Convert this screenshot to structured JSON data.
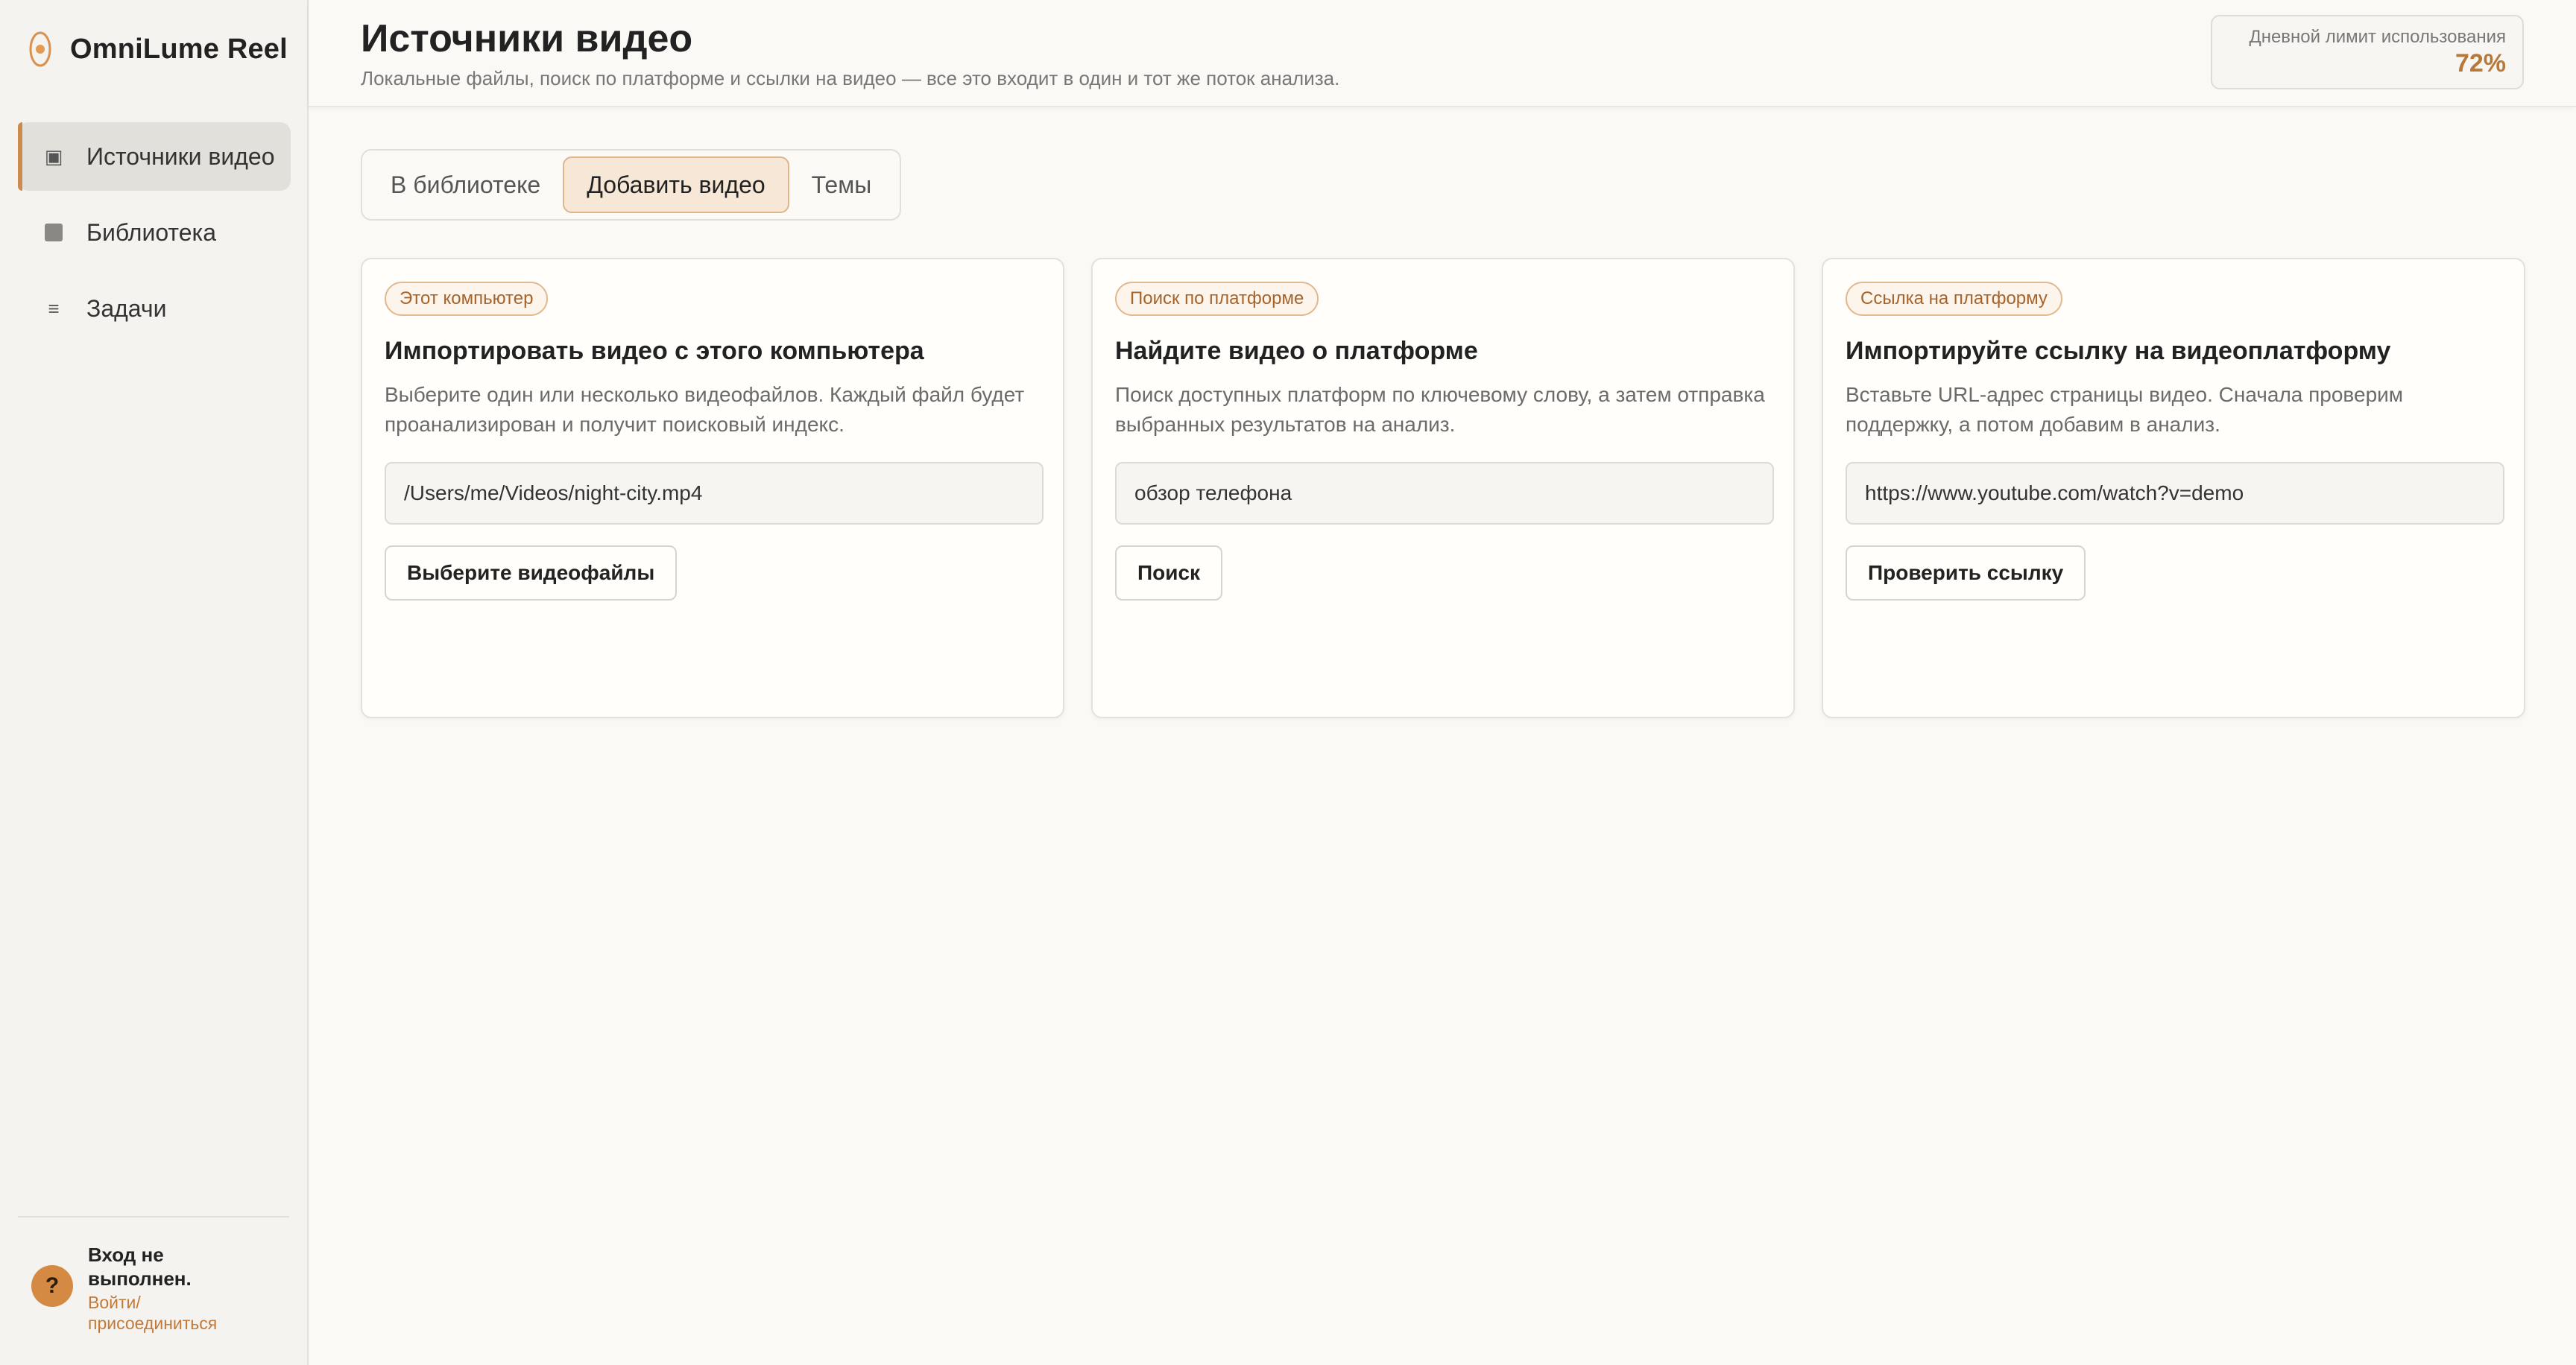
{
  "app": {
    "name": "OmniLume Reel"
  },
  "sidebar": {
    "items": [
      {
        "label": "Источники видео",
        "icon": "video-source-icon",
        "active": true
      },
      {
        "label": "Библиотека",
        "icon": "library-icon",
        "active": false
      },
      {
        "label": "Задачи",
        "icon": "tasks-icon",
        "active": false
      }
    ]
  },
  "account": {
    "avatar": "?",
    "status": "Вход не выполнен.",
    "link": "Войти/ присоединиться"
  },
  "header": {
    "title": "Источники видео",
    "subtitle": "Локальные файлы, поиск по платформе и ссылки на видео — все это входит в один и тот же поток анализа.",
    "usage_label": "Дневной лимит использования",
    "usage_value": "72%"
  },
  "tabs": [
    {
      "label": "В библиотеке",
      "active": false
    },
    {
      "label": "Добавить видео",
      "active": true
    },
    {
      "label": "Темы",
      "active": false
    }
  ],
  "cards": [
    {
      "badge": "Этот компьютер",
      "title": "Импортировать видео с этого компьютера",
      "description": "Выберите один или несколько видеофайлов. Каждый файл будет проанализирован и получит поисковый индекс.",
      "input_value": "/Users/me/Videos/night-city.mp4",
      "button": "Выберите видеофайлы"
    },
    {
      "badge": "Поиск по платформе",
      "title": "Найдите видео о платформе",
      "description": "Поиск доступных платформ по ключевому слову, а затем отправка выбранных результатов на анализ.",
      "input_value": "обзор телефона",
      "button": "Поиск"
    },
    {
      "badge": "Ссылка на платформу",
      "title": "Импортируйте ссылку на видеоплатформу",
      "description": "Вставьте URL-адрес страницы видео. Сначала проверим поддержку, а потом добавим в анализ.",
      "input_value": "https://www.youtube.com/watch?v=demo",
      "button": "Проверить ссылку"
    }
  ],
  "colors": {
    "accent": "#c98b4f",
    "accent_text": "#b8783a",
    "background": "#faf9f6",
    "sidebar_bg": "#f5f3ef"
  }
}
